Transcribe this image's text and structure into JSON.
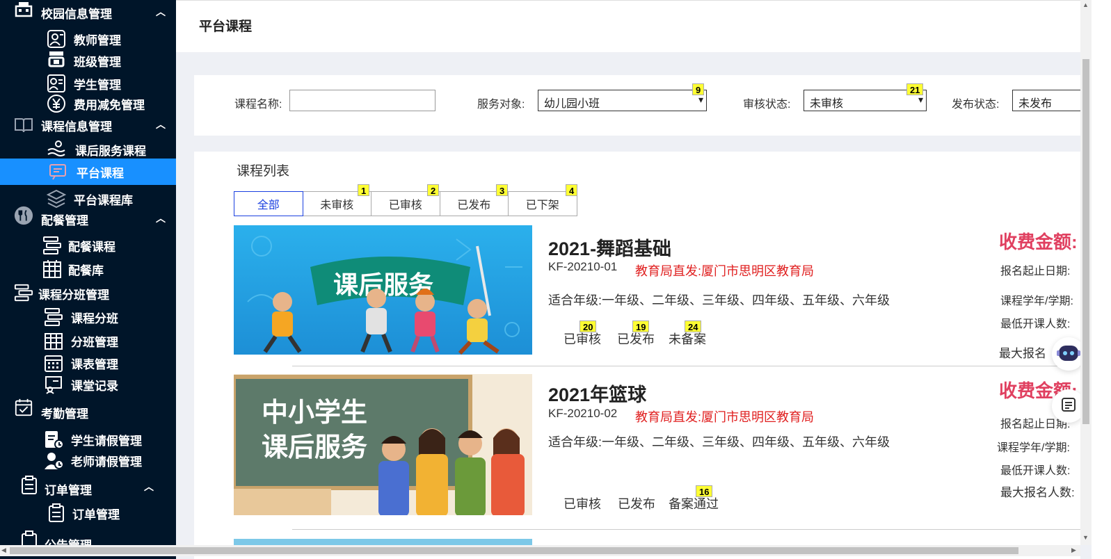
{
  "sidebar": {
    "groups": [
      {
        "label": "校园信息管理",
        "icon": "school-building-icon"
      },
      {
        "label": "课程信息管理",
        "icon": "book-icon"
      },
      {
        "label": "配餐管理",
        "icon": "fork-knife-icon"
      },
      {
        "label": "课程分班管理",
        "icon": "class-group-icon"
      },
      {
        "label": "考勤管理",
        "icon": "calendar-check-icon"
      },
      {
        "label": "订单管理",
        "icon": "order-document-icon"
      },
      {
        "label": "公告管理",
        "icon": "announcement-icon"
      }
    ],
    "items": [
      {
        "label": "教师管理",
        "icon": "teacher-icon"
      },
      {
        "label": "班级管理",
        "icon": "classroom-icon"
      },
      {
        "label": "学生管理",
        "icon": "student-icon"
      },
      {
        "label": "费用减免管理",
        "icon": "yen-coin-icon"
      },
      {
        "label": "课后服务课程",
        "icon": "service-course-icon"
      },
      {
        "label": "平台课程",
        "icon": "platform-course-icon"
      },
      {
        "label": "平台课程库",
        "icon": "layers-icon"
      },
      {
        "label": "配餐课程",
        "icon": "meal-course-icon"
      },
      {
        "label": "配餐库",
        "icon": "meal-library-icon"
      },
      {
        "label": "课程分班",
        "icon": "course-class-icon"
      },
      {
        "label": "分班管理",
        "icon": "class-grid-icon"
      },
      {
        "label": "课表管理",
        "icon": "timetable-icon"
      },
      {
        "label": "课堂记录",
        "icon": "class-record-icon"
      },
      {
        "label": "学生请假管理",
        "icon": "student-leave-icon"
      },
      {
        "label": "老师请假管理",
        "icon": "teacher-leave-icon"
      },
      {
        "label": "订单管理",
        "icon": "order-list-icon"
      }
    ]
  },
  "header": {
    "title": "平台课程"
  },
  "filter": {
    "course_name_label": "课程名称:",
    "course_name_value": "",
    "service_label": "服务对象:",
    "service_value": "幼儿园小班",
    "review_label": "审核状态:",
    "review_value": "未审核",
    "publish_label": "发布状态:",
    "publish_value": "未发布"
  },
  "badges": {
    "service_select": "9",
    "review_select": "21",
    "tab_unreviewed": "1",
    "tab_reviewed": "2",
    "tab_published": "3",
    "tab_offshelf": "4",
    "c1_reviewed": "20",
    "c1_published": "19",
    "c1_unfiled": "24",
    "c2_filed": "16"
  },
  "list": {
    "title": "课程列表",
    "tabs": [
      "全部",
      "未审核",
      "已审核",
      "已发布",
      "已下架"
    ]
  },
  "courses": [
    {
      "name": "2021-舞蹈基础",
      "code": "KF-20210-01",
      "issuer": "教育局直发:厦门市思明区教育局",
      "grades": "适合年级:一年级、二年级、三年级、四年级、五年级、六年级",
      "statuses": [
        "已审核",
        "已发布",
        "未备案"
      ],
      "fee_label": "收费金额:",
      "meta": [
        "报名起止日期:",
        "课程学年/学期:",
        "最低开课人数:",
        "最大报名"
      ],
      "banner_text": "课后服务"
    },
    {
      "name": "2021年篮球",
      "code": "KF-20210-02",
      "issuer": "教育局直发:厦门市思明区教育局",
      "grades": "适合年级:一年级、二年级、三年级、四年级、五年级、六年级",
      "statuses": [
        "已审核",
        "已发布",
        "备案通过"
      ],
      "fee_label": "收费金额:",
      "meta": [
        "报名起止日期:",
        "课程学年/学期:",
        "最低开课人数:",
        "最大报名人数:"
      ],
      "banner_line1": "中小学生",
      "banner_line2": "课后服务"
    }
  ],
  "colors": {
    "sidebar_bg": "#001529",
    "active_blue": "#1890ff",
    "fee_red": "#e04060",
    "issuer_red": "#e02020"
  }
}
